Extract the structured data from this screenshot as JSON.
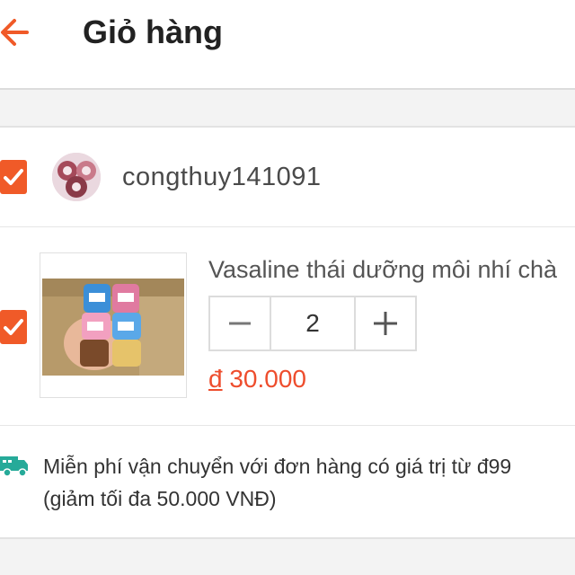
{
  "header": {
    "title": "Giỏ hàng",
    "back_icon": "arrow-left-icon",
    "accent_color": "#f05a28"
  },
  "shop": {
    "name": "congthuy141091",
    "checked": true
  },
  "item": {
    "name": "Vasaline thái dưỡng môi nhí chà",
    "quantity": "2",
    "currency_symbol": "đ",
    "price": "30.000",
    "checked": true,
    "minus_icon": "minus-icon",
    "plus_icon": "plus-icon"
  },
  "shipping": {
    "icon": "truck-icon",
    "line1": "Miễn phí vận chuyển với đơn hàng có giá trị từ đ99",
    "line2": "(giảm tối đa 50.000 VNĐ)"
  }
}
